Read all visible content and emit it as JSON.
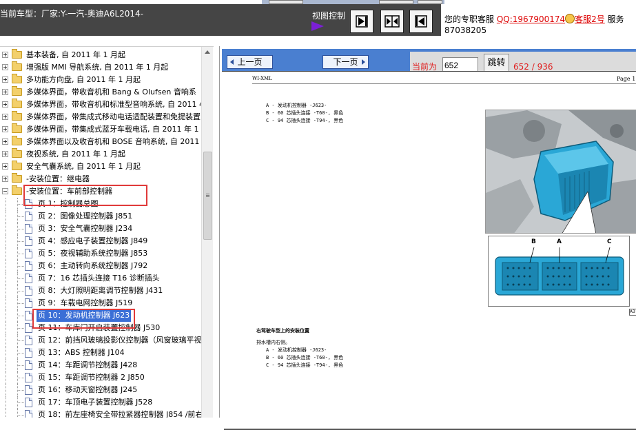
{
  "header": {
    "vehicle_label": "当前车型：厂家:Y-一汽-奥迪A6L2014-",
    "view_control_label": "视图控制",
    "view_buttons": [
      "view-next-icon",
      "view-split-icon",
      "view-prev-icon"
    ],
    "service": {
      "prefix": "您的专职客服",
      "qq": "QQ:1967900174",
      "kf": "客服2号",
      "suffix": "服务",
      "line2": "87038205"
    }
  },
  "tree": {
    "items": [
      {
        "type": "folder",
        "expander": "plus",
        "label": "基本装备, 自 2011 年 1 月起"
      },
      {
        "type": "folder",
        "expander": "plus",
        "label": "增强版 MMI 导航系统, 自 2011 年 1 月起"
      },
      {
        "type": "folder",
        "expander": "plus",
        "label": "多功能方向盘, 自 2011 年 1 月起"
      },
      {
        "type": "folder",
        "expander": "plus",
        "label": "多媒体界面，带收音机和 Bang & Olufsen 音响系"
      },
      {
        "type": "folder",
        "expander": "plus",
        "label": "多媒体界面，带收音机和标准型音响系统, 自 2011 4"
      },
      {
        "type": "folder",
        "expander": "plus",
        "label": "多媒体界面，带集成式移动电话适配装置和免提装置"
      },
      {
        "type": "folder",
        "expander": "plus",
        "label": "多媒体界面，带集成式蓝牙车载电话, 自 2011 年 1"
      },
      {
        "type": "folder",
        "expander": "plus",
        "label": "多媒体界面以及收音机和 BOSE 音响系统, 自 2011"
      },
      {
        "type": "folder",
        "expander": "plus",
        "label": "夜视系统, 自 2011 年 1 月起"
      },
      {
        "type": "folder",
        "expander": "plus",
        "label": "安全气囊系统, 自 2011 年 1 月起"
      },
      {
        "type": "folder",
        "expander": "plus",
        "label": "-安装位置：继电器"
      },
      {
        "type": "folder",
        "expander": "minus",
        "label": "-安装位置：车前部控制器"
      },
      {
        "type": "page",
        "label": "页 1：控制器总图"
      },
      {
        "type": "page",
        "label": "页 2：图像处理控制器 J851"
      },
      {
        "type": "page",
        "label": "页 3：安全气囊控制器 J234"
      },
      {
        "type": "page",
        "label": "页 4：感应电子装置控制器 J849"
      },
      {
        "type": "page",
        "label": "页 5：夜视辅助系统控制器 J853"
      },
      {
        "type": "page",
        "label": "页 6：主动转向系统控制器 J792"
      },
      {
        "type": "page",
        "label": "页 7：16 芯插头连接 T16 诊断插头"
      },
      {
        "type": "page",
        "label": "页 8：大灯照明距离调节控制器 J431"
      },
      {
        "type": "page",
        "label": "页 9：车载电网控制器 J519"
      },
      {
        "type": "page",
        "label": "页 10：发动机控制器 J623",
        "selected": true
      },
      {
        "type": "page",
        "label": "页 11：车库门开启装置控制器 J530"
      },
      {
        "type": "page",
        "label": "页 12：前挡风玻璃投影仪控制器（风窗玻璃平视"
      },
      {
        "type": "page",
        "label": "页 13：ABS 控制器 J104"
      },
      {
        "type": "page",
        "label": "页 14：车距调节控制器 J428"
      },
      {
        "type": "page",
        "label": "页 15：车距调节控制器 2 J850"
      },
      {
        "type": "page",
        "label": "页 16：移动天窗控制器 J245"
      },
      {
        "type": "page",
        "label": "页 17：车顶电子装置控制器 J528"
      },
      {
        "type": "page",
        "label": "页 18：前左座椅安全带拉紧器控制器 J854 /前右"
      }
    ]
  },
  "viewer": {
    "prev_label": "上一页",
    "next_label": "下一页",
    "current_label": "当前为",
    "page_input_value": "652",
    "jump_label": "跳转",
    "page_count": "652 / 936",
    "doc_header_left": "WI-XML",
    "doc_header_right": "Page 1",
    "legend_top": [
      "A - 发动机控制器 -J623-",
      "B - 60 芯插头连接 -T60-, 黑色",
      "C - 94 芯插头连接 -T94-, 黑色"
    ],
    "section_title": "右驾驶车型上的安装位置",
    "section_sub": "排水槽内右侧。",
    "legend_bottom": [
      "A - 发动机控制器 -J623-",
      "B - 60 芯插头连接 -T60-, 黑色",
      "C - 94 芯插头连接 -T94-, 黑色"
    ],
    "connector_labels": [
      "B",
      "A",
      "C"
    ],
    "corner_tag": "A3"
  }
}
